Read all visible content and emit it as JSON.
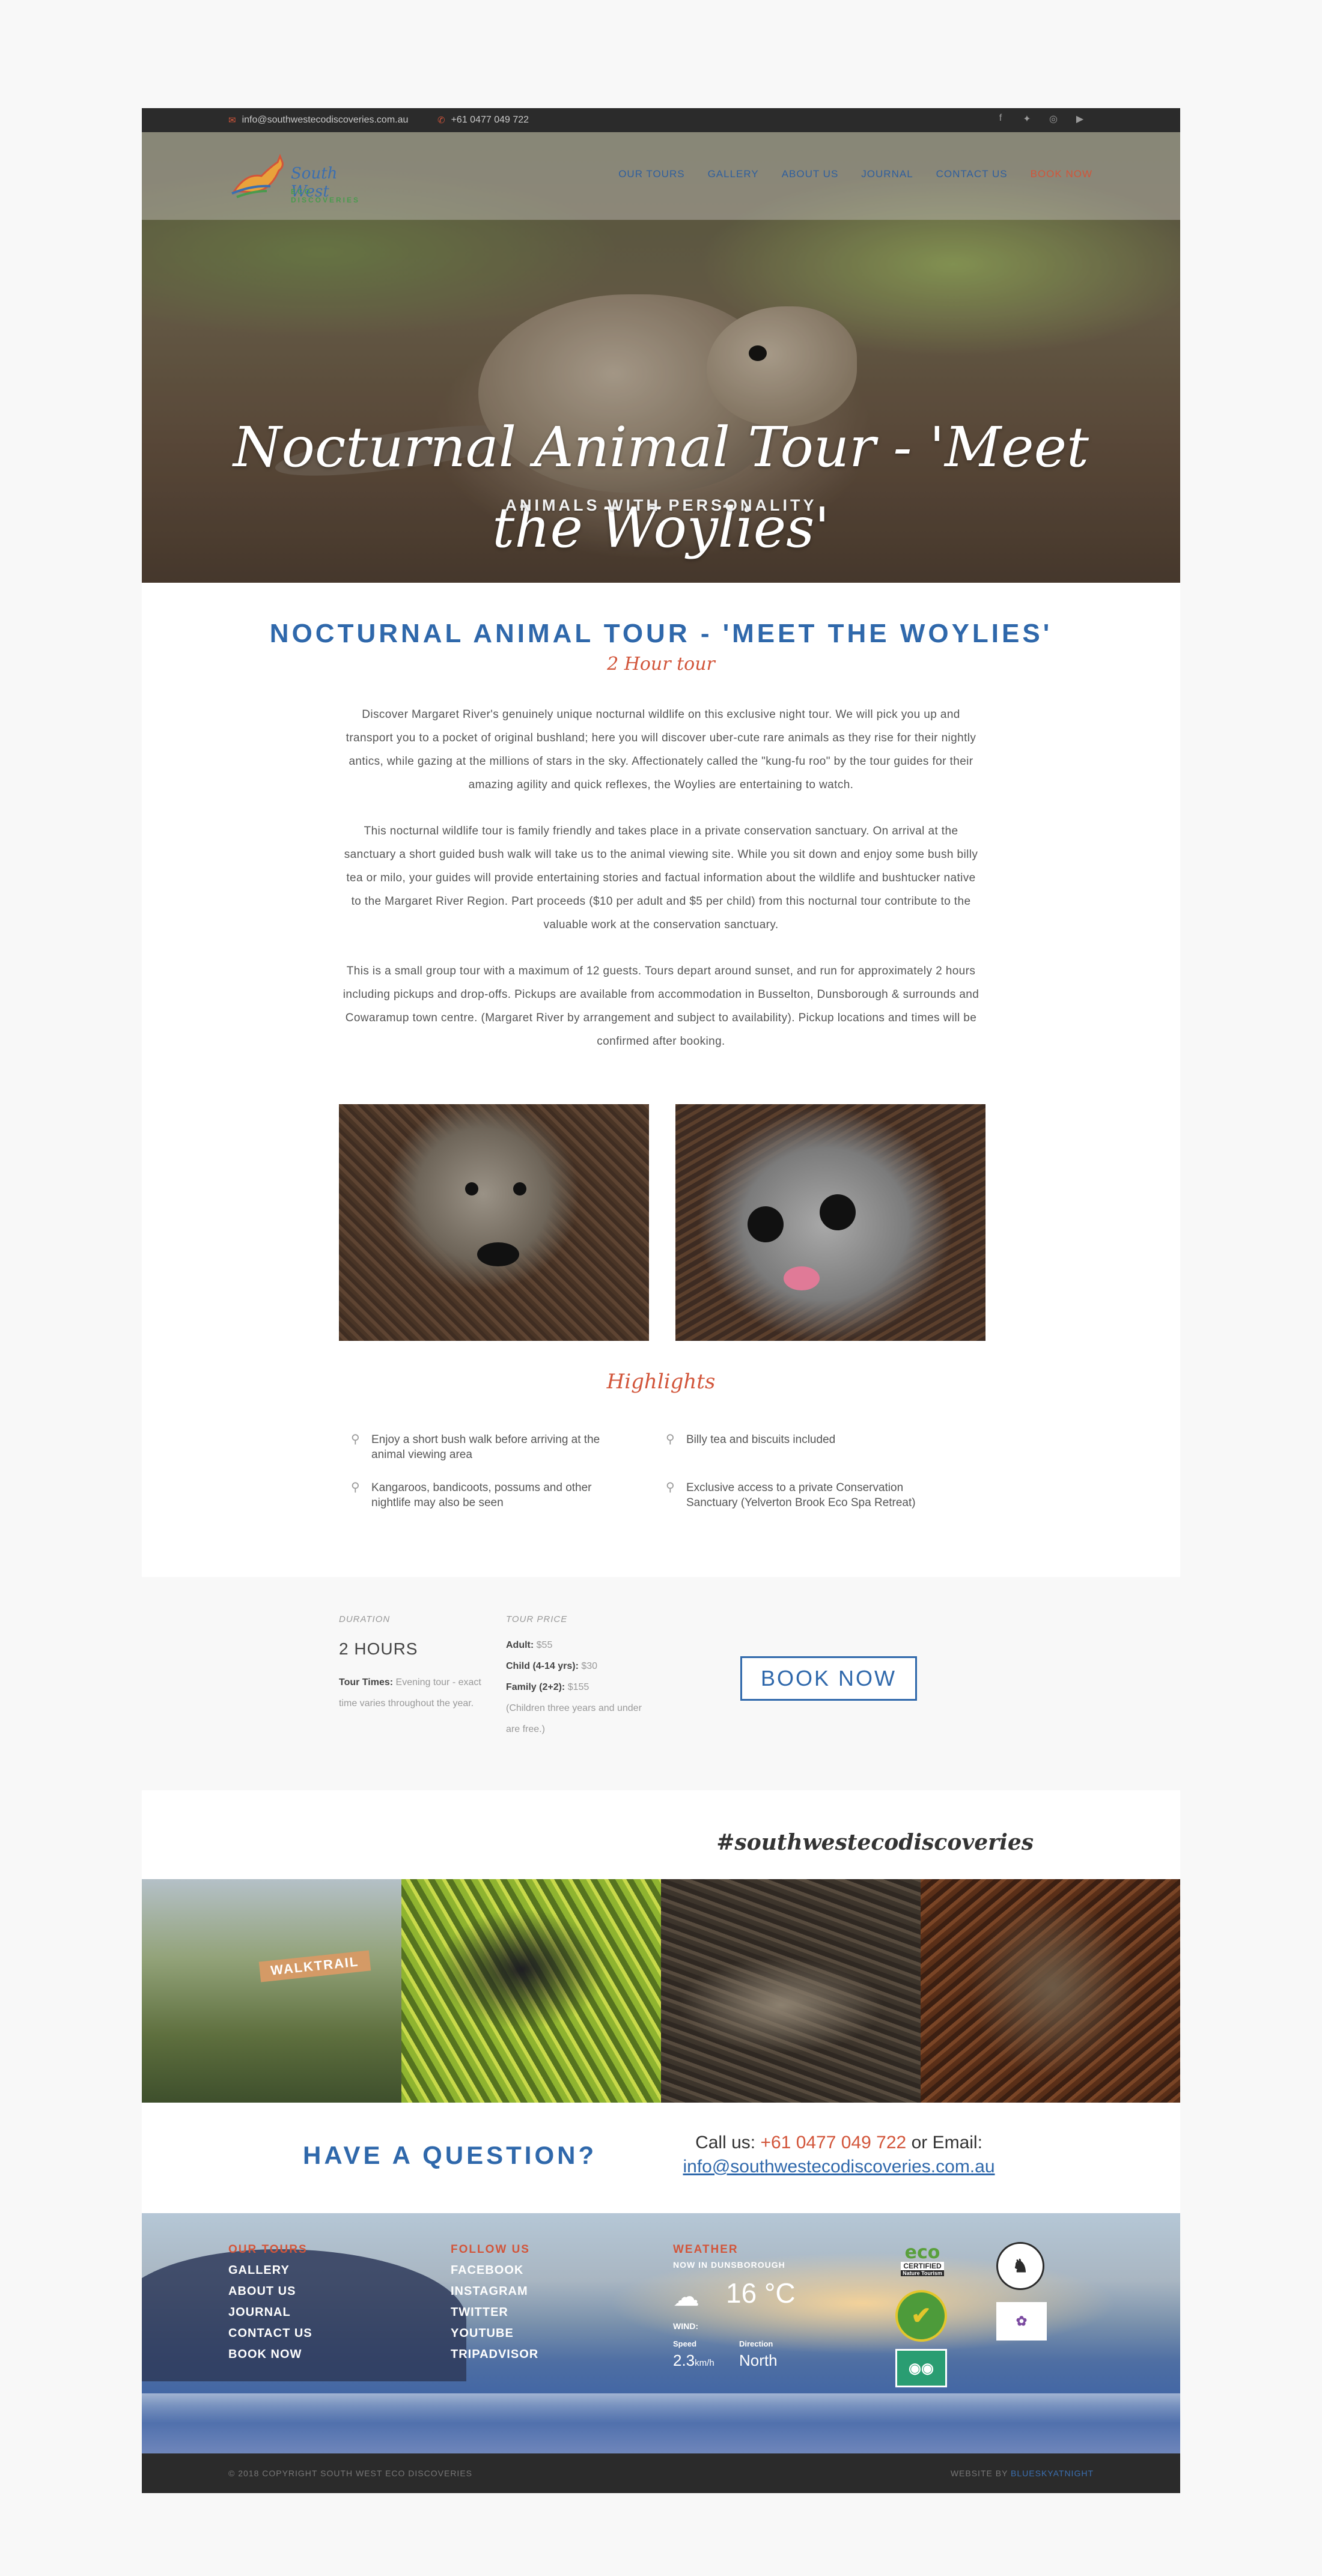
{
  "topbar": {
    "email": "info@southwestecodiscoveries.com.au",
    "phone": "+61 0477 049 722",
    "social": [
      {
        "icon": "facebook-icon",
        "glyph": "f"
      },
      {
        "icon": "twitter-icon",
        "glyph": "🐦"
      },
      {
        "icon": "instagram-icon",
        "glyph": "◎"
      },
      {
        "icon": "youtube-icon",
        "glyph": "▶"
      }
    ]
  },
  "logo": {
    "line1": "South West",
    "line2": "ECO DISCOVERIES"
  },
  "nav": [
    "OUR TOURS",
    "GALLERY",
    "ABOUT US",
    "JOURNAL",
    "CONTACT US",
    "BOOK NOW"
  ],
  "hero": {
    "title": "Nocturnal Animal Tour - 'Meet the Woylies'",
    "subtitle": "ANIMALS WITH PERSONALITY"
  },
  "tour": {
    "title": "NOCTURNAL ANIMAL TOUR - 'MEET THE WOYLIES'",
    "duration_sub": "2 Hour tour",
    "paragraphs": [
      "Discover Margaret River's genuinely unique nocturnal wildlife on this exclusive night tour. We will pick you up and transport you to a pocket of original bushland; here you will discover uber-cute rare animals as they rise for their nightly antics, while gazing at the millions of stars in the sky. Affectionately called the \"kung-fu roo\" by the tour guides for their amazing agility and quick reflexes, the Woylies are entertaining to watch.",
      "This nocturnal wildlife tour is family friendly and takes place in a private conservation sanctuary. On arrival at the sanctuary a short guided bush walk will take us to the animal viewing site. While you sit down and enjoy some bush billy tea or milo, your guides will provide entertaining stories and factual information about the wildlife and bushtucker native to the Margaret River Region. Part proceeds ($10 per adult and $5 per child) from this nocturnal tour contribute to the valuable work at the conservation sanctuary.",
      "This is a small group tour with a maximum of 12 guests. Tours depart around sunset, and run for approximately 2 hours including pickups and drop-offs. Pickups are available from accommodation in Busselton, Dunsborough & surrounds and Cowaramup town centre. (Margaret River by arrangement and subject to availability). Pickup locations and times will be confirmed after booking."
    ]
  },
  "highlights": {
    "title": "Highlights",
    "items": [
      "Enjoy a short bush walk before arriving at the animal viewing area",
      "Billy tea and biscuits included",
      "Kangaroos, bandicoots, possums and other nightlife may also be seen",
      "Exclusive access to a private Conservation Sanctuary (Yelverton Brook Eco Spa Retreat)"
    ]
  },
  "info": {
    "duration_label": "DURATION",
    "duration_value": "2 HOURS",
    "tour_times_label": "Tour Times:",
    "tour_times_value": "Evening tour - exact time varies throughout the year.",
    "price_label": "TOUR PRICE",
    "prices": [
      {
        "label": "Adult:",
        "value": "$55"
      },
      {
        "label": "Child (4-14 yrs):",
        "value": "$30"
      },
      {
        "label": "Family (2+2):",
        "value": "$155"
      }
    ],
    "price_note": "(Children three years and under are free.)",
    "book_button": "BOOK NOW"
  },
  "instagram": {
    "hashtag": "#southwestecodiscoveries",
    "sign_text": "WALKTRAIL"
  },
  "question": {
    "title": "HAVE A QUESTION?",
    "call_prefix": "Call us:",
    "phone": "+61 0477 049 722",
    "or_email": "or Email:",
    "email": "info@southwestecodiscoveries.com.au"
  },
  "footer": {
    "tours_head": "OUR TOURS",
    "tours_links": [
      "GALLERY",
      "ABOUT US",
      "JOURNAL",
      "CONTACT US",
      "BOOK NOW"
    ],
    "follow_head": "FOLLOW US",
    "follow_links": [
      "FACEBOOK",
      "INSTAGRAM",
      "TWITTER",
      "YOUTUBE",
      "TRIPADVISOR"
    ],
    "weather_head": "WEATHER",
    "weather_now": "NOW IN DUNSBOROUGH",
    "temp": "16 °C",
    "wind_label": "WIND:",
    "speed_label": "Speed",
    "speed_value": "2.3",
    "speed_unit": "km/h",
    "direction_label": "Direction",
    "direction_value": "North",
    "badges": {
      "eco_title": "eco",
      "eco_sub": "CERTIFIED",
      "eco_sub2": "Nature Tourism"
    },
    "copyright": "© 2018 COPYRIGHT SOUTH WEST ECO DISCOVERIES",
    "credit_prefix": "WEBSITE BY",
    "credit_name": "BLUESKYATNIGHT"
  },
  "colors": {
    "brand_blue": "#2f68ab",
    "accent_orange": "#d2553a",
    "dark_bar": "#2b2b2b"
  }
}
